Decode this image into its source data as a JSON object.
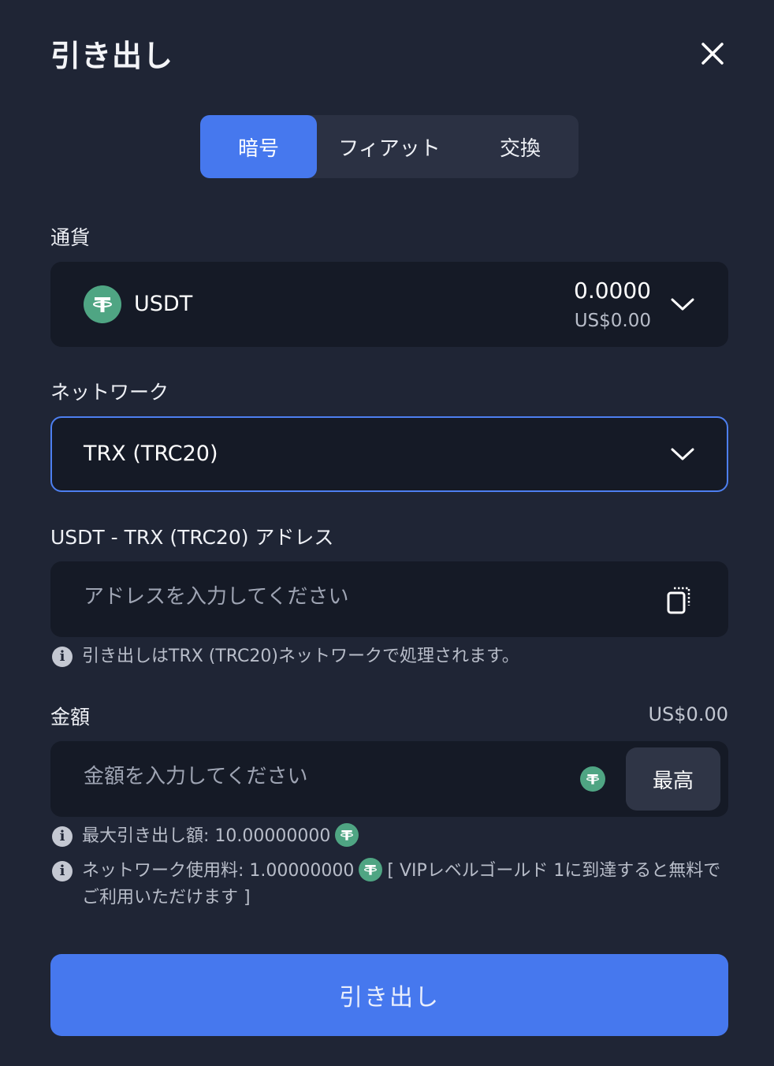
{
  "modal": {
    "title": "引き出し"
  },
  "tabs": [
    {
      "label": "暗号",
      "active": true
    },
    {
      "label": "フィアット",
      "active": false
    },
    {
      "label": "交換",
      "active": false
    }
  ],
  "currency": {
    "label": "通貨",
    "symbol": "USDT",
    "balance": "0.0000",
    "balance_usd": "US$0.00",
    "icon": "tether-icon"
  },
  "network": {
    "label": "ネットワーク",
    "selected": "TRX (TRC20)"
  },
  "address": {
    "label": "USDT - TRX (TRC20) アドレス",
    "placeholder": "アドレスを入力してください",
    "value": "",
    "note": "引き出しはTRX (TRC20)ネットワークで処理されます。"
  },
  "amount": {
    "label": "金額",
    "usd_value": "US$0.00",
    "placeholder": "金額を入力してください",
    "value": "",
    "max_label": "最高",
    "max_withdraw_label": "最大引き出し額: 10.00000000",
    "fee_label": "ネットワーク使用料: 1.00000000",
    "fee_note": "[ VIPレベルゴールド 1に到達すると無料でご利用いただけます ]"
  },
  "submit": {
    "label": "引き出し"
  },
  "colors": {
    "background": "#1f2535",
    "field": "#151a26",
    "accent": "#4678ee",
    "tether": "#4fa583"
  }
}
